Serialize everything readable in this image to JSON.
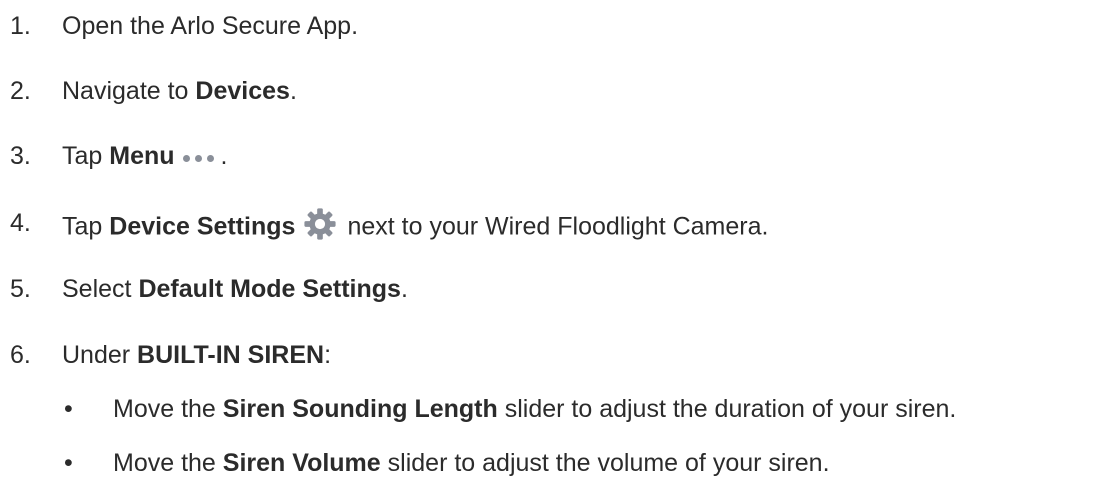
{
  "steps": [
    {
      "num": "1.",
      "text": "Open the Arlo Secure App."
    },
    {
      "num": "2.",
      "pre": "Navigate to ",
      "bold": "Devices",
      "post": "."
    },
    {
      "num": "3.",
      "pre": "Tap ",
      "bold": "Menu",
      "post": "."
    },
    {
      "num": "4.",
      "pre": "Tap ",
      "bold": "Device Settings",
      "post": "next to your Wired Floodlight Camera."
    },
    {
      "num": "5.",
      "pre": "Select ",
      "bold": "Default Mode Settings",
      "post": "."
    },
    {
      "num": "6.",
      "pre": "Under ",
      "bold": "BUILT-IN SIREN",
      "post": ":"
    }
  ],
  "substeps": [
    {
      "bullet": "•",
      "pre": "Move the ",
      "bold": "Siren Sounding Length",
      "post": " slider to adjust the duration of your siren."
    },
    {
      "bullet": "•",
      "pre": "Move the ",
      "bold": "Siren Volume",
      "post": " slider to adjust the volume of your siren."
    }
  ],
  "icons": {
    "menu": "more-dots-icon",
    "settings": "gear-icon",
    "icon_color": "#8a8f99"
  },
  "colors": {
    "text": "#2b2b2b",
    "background": "#ffffff"
  }
}
